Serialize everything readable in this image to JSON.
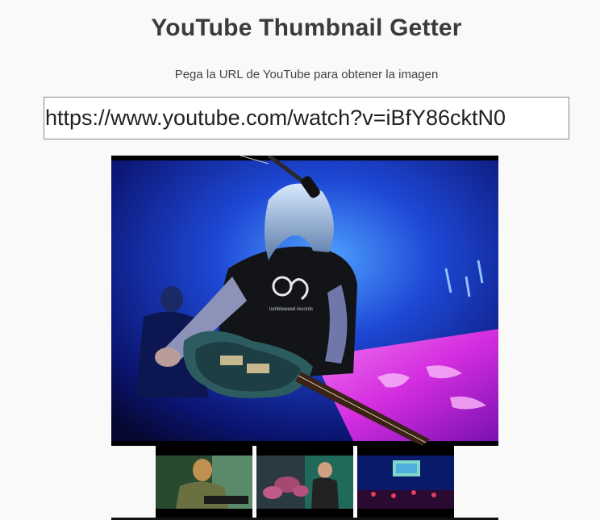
{
  "header": {
    "title": "YouTube Thumbnail Getter",
    "subtitle": "Pega la URL de YouTube para obtener la imagen"
  },
  "url_input": {
    "value": "https://www.youtube.com/watch?v=iBfY86cktN0"
  },
  "thumbnails": {
    "main": {
      "shirt_text": "tumbleweed records"
    },
    "small": [
      "thumbnail-1",
      "thumbnail-2",
      "thumbnail-3"
    ]
  },
  "colors": {
    "background": "#f9f9f9",
    "title": "#3b3b3b",
    "stage_blue": "#1a3fbf",
    "stage_pink": "#e040e8"
  }
}
